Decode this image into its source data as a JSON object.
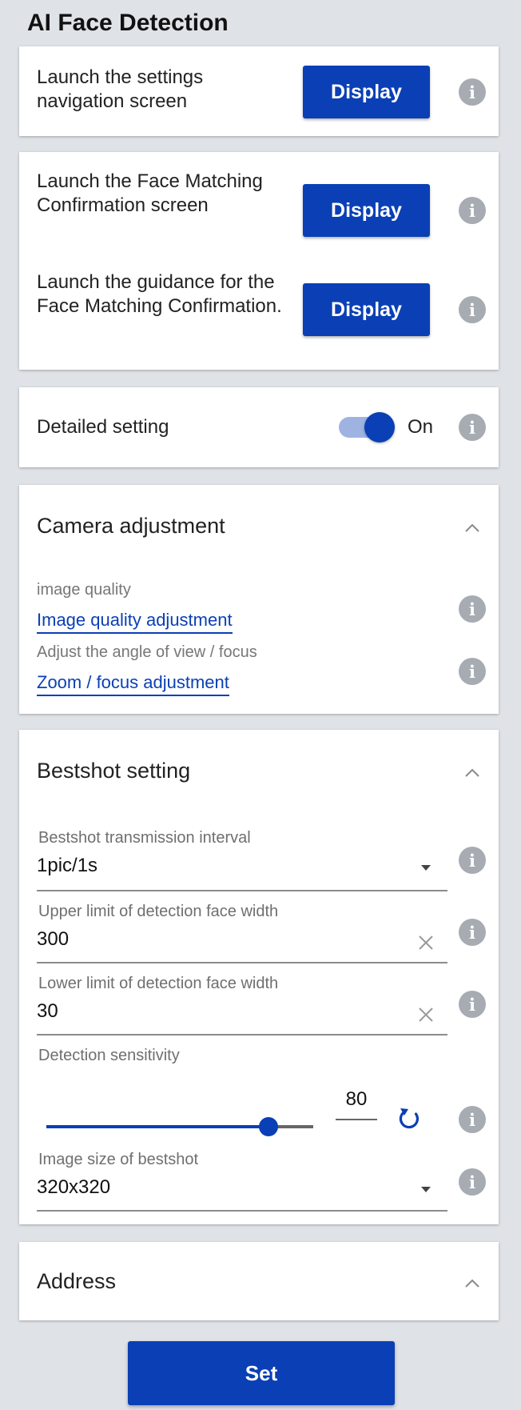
{
  "page": {
    "title": "AI Face Detection",
    "info_glyph": "i"
  },
  "nav_card": {
    "label": "Launch the settings navigation screen",
    "button": "Display"
  },
  "face_card": {
    "confirmation_label": "Launch the Face Matching Confirmation screen",
    "confirmation_button": "Display",
    "guidance_label": "Launch the guidance for the Face Matching Confirmation.",
    "guidance_button": "Display"
  },
  "detailed": {
    "label": "Detailed setting",
    "toggle_state": "On",
    "toggle_on": true
  },
  "camera": {
    "title": "Camera adjustment",
    "image_quality_caption": "image quality",
    "image_quality_link": "Image quality adjustment",
    "zoom_caption": "Adjust the angle of view / focus",
    "zoom_link": "Zoom / focus adjustment"
  },
  "bestshot": {
    "title": "Bestshot setting",
    "interval_label": "Bestshot transmission interval",
    "interval_value": "1pic/1s",
    "upper_label": "Upper limit of detection face width",
    "upper_value": "300",
    "lower_label": "Lower limit of detection face width",
    "lower_value": "30",
    "sensitivity_label": "Detection sensitivity",
    "sensitivity_value": "80",
    "size_label": "Image size of bestshot",
    "size_value": "320x320"
  },
  "address": {
    "title": "Address"
  },
  "footer": {
    "set_button": "Set"
  },
  "colors": {
    "accent": "#0a3fb5",
    "background": "#dfe2e6",
    "info_icon": "#a7abb2"
  },
  "icons": [
    "info-icon",
    "chevron-up-icon",
    "dropdown-arrow-icon",
    "clear-icon",
    "reset-icon"
  ]
}
